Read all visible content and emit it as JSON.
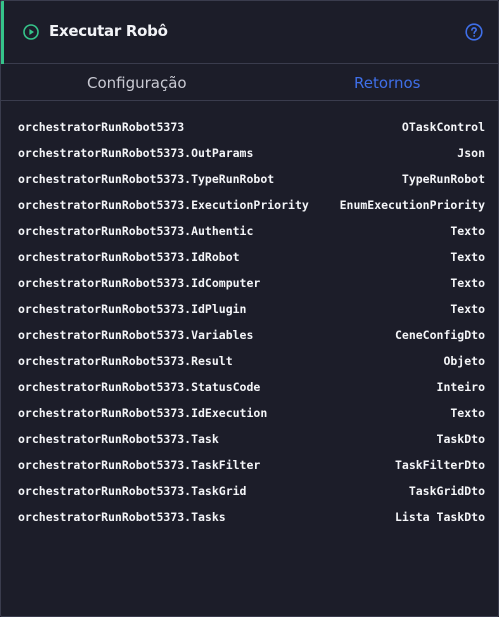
{
  "header": {
    "title": "Executar Robô",
    "accent_color": "#35c48a",
    "icon": "play-circle-icon",
    "help_icon": "help-circle-icon"
  },
  "tabs": [
    {
      "label": "Configuração",
      "active": false
    },
    {
      "label": "Retornos",
      "active": true
    }
  ],
  "returns": [
    {
      "name": "orchestratorRunRobot5373",
      "type": "OTaskControl"
    },
    {
      "name": "orchestratorRunRobot5373.OutParams",
      "type": "Json"
    },
    {
      "name": "orchestratorRunRobot5373.TypeRunRobot",
      "type": "TypeRunRobot"
    },
    {
      "name": "orchestratorRunRobot5373.ExecutionPriority",
      "type": "EnumExecutionPriority"
    },
    {
      "name": "orchestratorRunRobot5373.Authentic",
      "type": "Texto"
    },
    {
      "name": "orchestratorRunRobot5373.IdRobot",
      "type": "Texto"
    },
    {
      "name": "orchestratorRunRobot5373.IdComputer",
      "type": "Texto"
    },
    {
      "name": "orchestratorRunRobot5373.IdPlugin",
      "type": "Texto"
    },
    {
      "name": "orchestratorRunRobot5373.Variables",
      "type": "CeneConfigDto"
    },
    {
      "name": "orchestratorRunRobot5373.Result",
      "type": "Objeto"
    },
    {
      "name": "orchestratorRunRobot5373.StatusCode",
      "type": "Inteiro"
    },
    {
      "name": "orchestratorRunRobot5373.IdExecution",
      "type": "Texto"
    },
    {
      "name": "orchestratorRunRobot5373.Task",
      "type": "TaskDto"
    },
    {
      "name": "orchestratorRunRobot5373.TaskFilter",
      "type": "TaskFilterDto"
    },
    {
      "name": "orchestratorRunRobot5373.TaskGrid",
      "type": "TaskGridDto"
    },
    {
      "name": "orchestratorRunRobot5373.Tasks",
      "type": "Lista TaskDto"
    }
  ]
}
